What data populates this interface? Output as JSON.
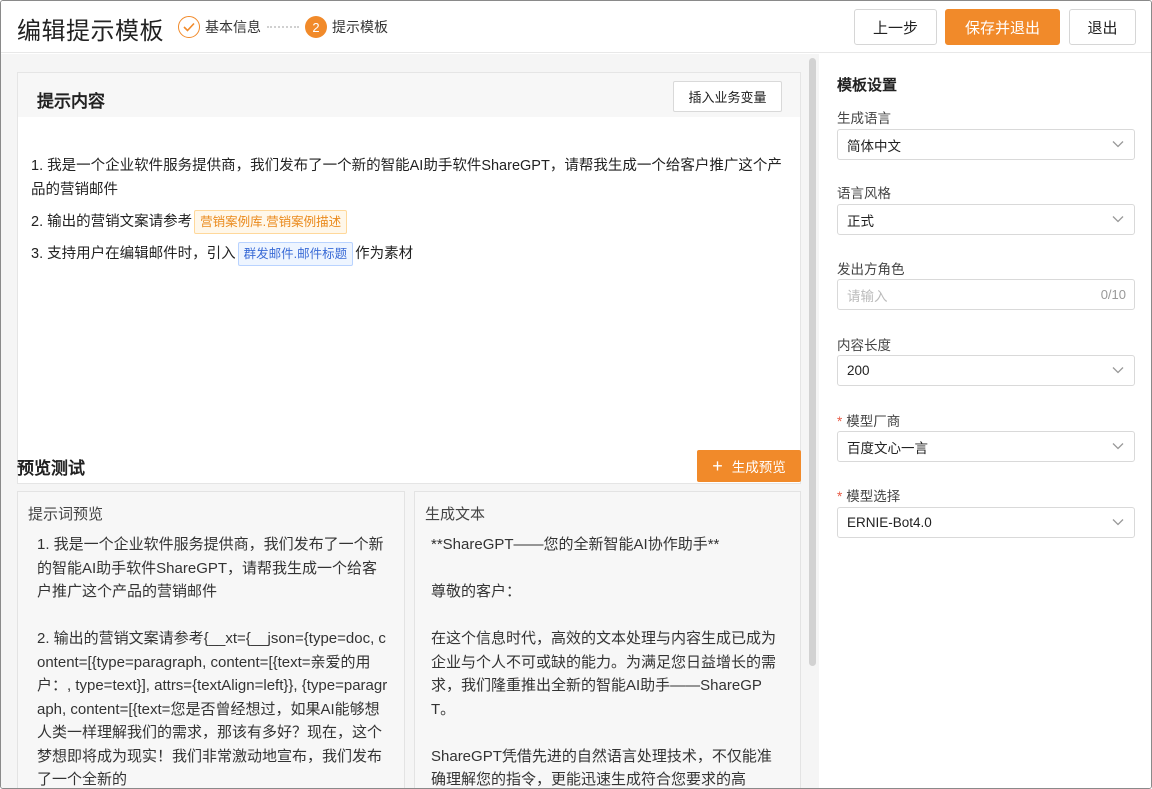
{
  "header": {
    "title": "编辑提示模板",
    "steps": [
      {
        "label": "基本信息",
        "status": "done"
      },
      {
        "label": "提示模板",
        "number": "2",
        "status": "active"
      }
    ],
    "buttons": {
      "prev": "上一步",
      "save_exit": "保存并退出",
      "exit": "退出"
    }
  },
  "prompt_card": {
    "title": "提示内容",
    "insert_button": "插入业务变量",
    "lines": [
      {
        "text": "1. 我是一个企业软件服务提供商，我们发布了一个新的智能AI助手软件ShareGPT，请帮我生成一个给客户推广这个产品的营销邮件"
      },
      {
        "prefix": "2. 输出的营销文案请参考",
        "tag": "营销案例库.营销案例描述"
      },
      {
        "prefix": "3. 支持用户在编辑邮件时，引入",
        "tag": "群发邮件.邮件标题",
        "suffix": "作为素材"
      }
    ]
  },
  "preview": {
    "title": "预览测试",
    "generate_button": "生成预览",
    "prompt_preview_title": "提示词预览",
    "prompt_preview_text": "1. 我是一个企业软件服务提供商，我们发布了一个新的智能AI助手软件ShareGPT，请帮我生成一个给客户推广这个产品的营销邮件\n\n2. 输出的营销文案请参考{__xt={__json={type=doc, content=[{type=paragraph, content=[{text=亲爱的用户：, type=text}], attrs={textAlign=left}}, {type=paragraph, content=[{text=您是否曾经想过，如果AI能够想人类一样理解我们的需求，那该有多好？现在，这个梦想即将成为现实！我们非常激动地宣布，我们发布了一个全新的",
    "generated_title": "生成文本",
    "generated_text": "**ShareGPT——您的全新智能AI协作助手**\n\n尊敬的客户：\n\n在这个信息时代，高效的文本处理与内容生成已成为企业与个人不可或缺的能力。为满足您日益增长的需求，我们隆重推出全新的智能AI助手——ShareGPT。\n\nShareGPT凭借先进的自然语言处理技术，不仅能准确理解您的指令，更能迅速生成符合您要求的高"
  },
  "settings": {
    "title": "模板设置",
    "fields": [
      {
        "label": "生成语言",
        "value": "简体中文",
        "required": false
      },
      {
        "label": "语言风格",
        "value": "正式",
        "required": false
      },
      {
        "label": "发出方角色",
        "placeholder": "请输入",
        "counter": "0/10",
        "required": false
      },
      {
        "label": "内容长度",
        "value": "200",
        "required": false
      },
      {
        "label": "模型厂商",
        "value": "百度文心一言",
        "required": true
      },
      {
        "label": "模型选择",
        "value": "ERNIE-Bot4.0",
        "required": true
      }
    ]
  },
  "colors": {
    "accent": "#f18a2a",
    "tag_orange_text": "#ea8a1c",
    "tag_blue_text": "#3a6bd6",
    "required": "#e85b46"
  }
}
